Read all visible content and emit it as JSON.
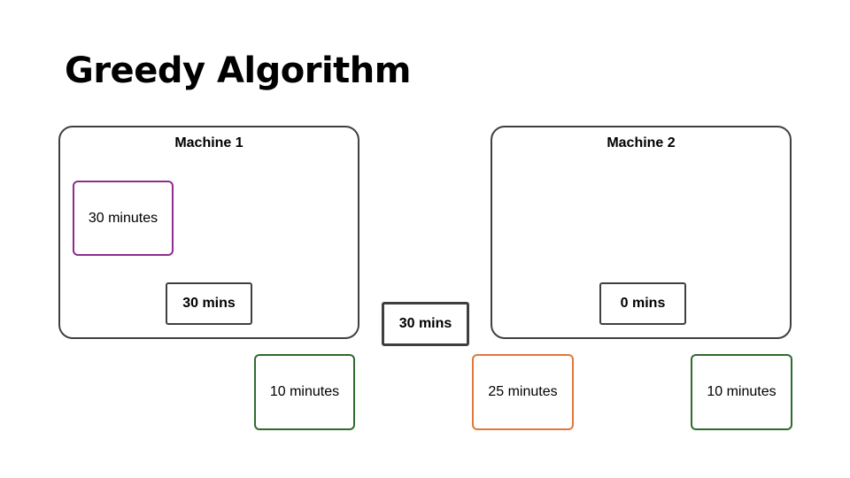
{
  "title": "Greedy Algorithm",
  "machines": [
    {
      "label": "Machine 1",
      "total": "30 mins"
    },
    {
      "label": "Machine 2",
      "total": "0 mins"
    }
  ],
  "current_job_size": "30 mins",
  "jobs": [
    {
      "label": "30 minutes",
      "color": "#8b2e8f",
      "location": "Machine 1"
    },
    {
      "label": "10 minutes",
      "color": "#2e6b2e",
      "location": "queue"
    },
    {
      "label": "25 minutes",
      "color": "#e0773b",
      "location": "queue"
    },
    {
      "label": "10 minutes",
      "color": "#2e6b2e",
      "location": "queue"
    }
  ]
}
